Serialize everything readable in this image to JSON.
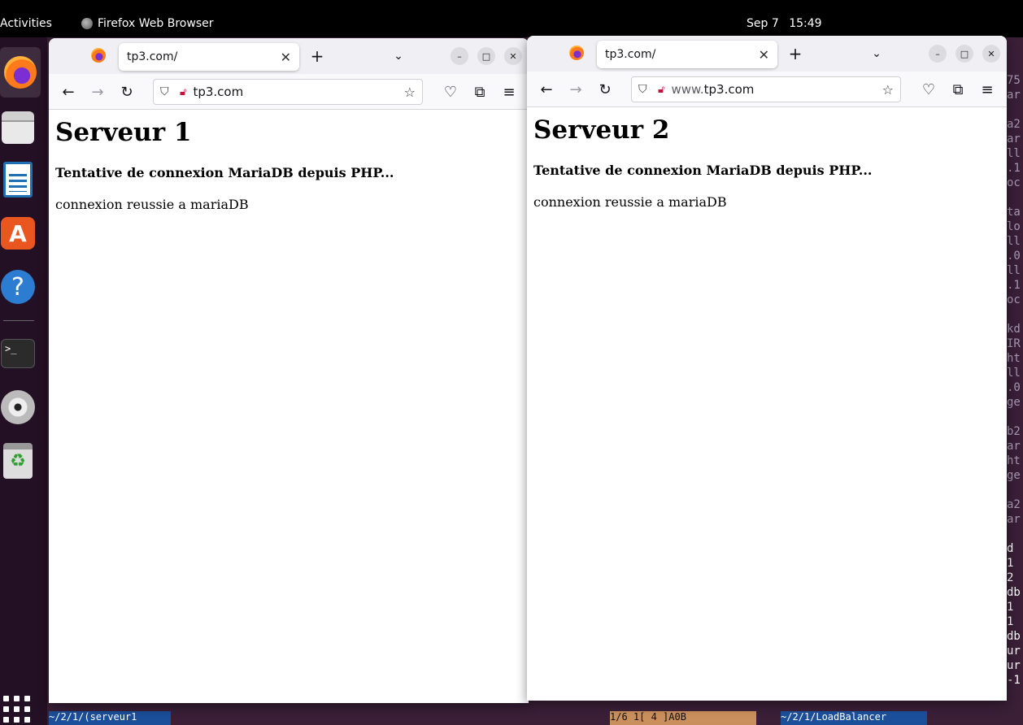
{
  "topbar": {
    "activities": "Activities",
    "app_name": "Firefox Web Browser",
    "date": "Sep 7",
    "time": "15:49"
  },
  "dock": {
    "items": [
      "firefox-icon",
      "files-icon",
      "writer-icon",
      "app-store-icon",
      "help-icon",
      "terminal-icon",
      "dvd-icon",
      "trash-icon"
    ],
    "terminal_glyph": ">_",
    "help_glyph": "?",
    "store_glyph": "A",
    "trash_glyph": "♻"
  },
  "windows": [
    {
      "tab_title": "tp3.com/",
      "url_prefix": "",
      "url_domain": "tp3.com",
      "heading": "Serveur 1",
      "subheading": "Tentative de connexion MariaDB depuis PHP...",
      "message": "connexion reussie a mariaDB"
    },
    {
      "tab_title": "tp3.com/",
      "url_prefix": "www.",
      "url_domain": "tp3.com",
      "heading": "Serveur 2",
      "subheading": "Tentative de connexion MariaDB depuis PHP...",
      "message": "connexion reussie a mariaDB"
    }
  ],
  "bg_terminal": {
    "lines": [
      "75",
      "ar",
      "",
      "a2",
      "ar",
      "ll",
      ".1",
      "oc",
      "",
      "ta",
      "lo",
      "ll",
      ".0",
      "ll",
      ".1",
      "oc",
      "",
      "kd",
      "IR",
      "ht",
      "ll",
      ".0",
      "ge",
      "",
      "b2",
      "ar",
      "ht",
      "ge",
      "",
      "a2",
      "ar",
      "",
      "d",
      "1",
      "2",
      "db",
      "1",
      "1",
      "db",
      "ur",
      "ur",
      "-1"
    ],
    "bottom_left": "~/2/1/(serveur1",
    "bottom_mid": "1/6  1[ 4 ]A0B",
    "bottom_right": "~/2/1/LoadBalancer"
  }
}
